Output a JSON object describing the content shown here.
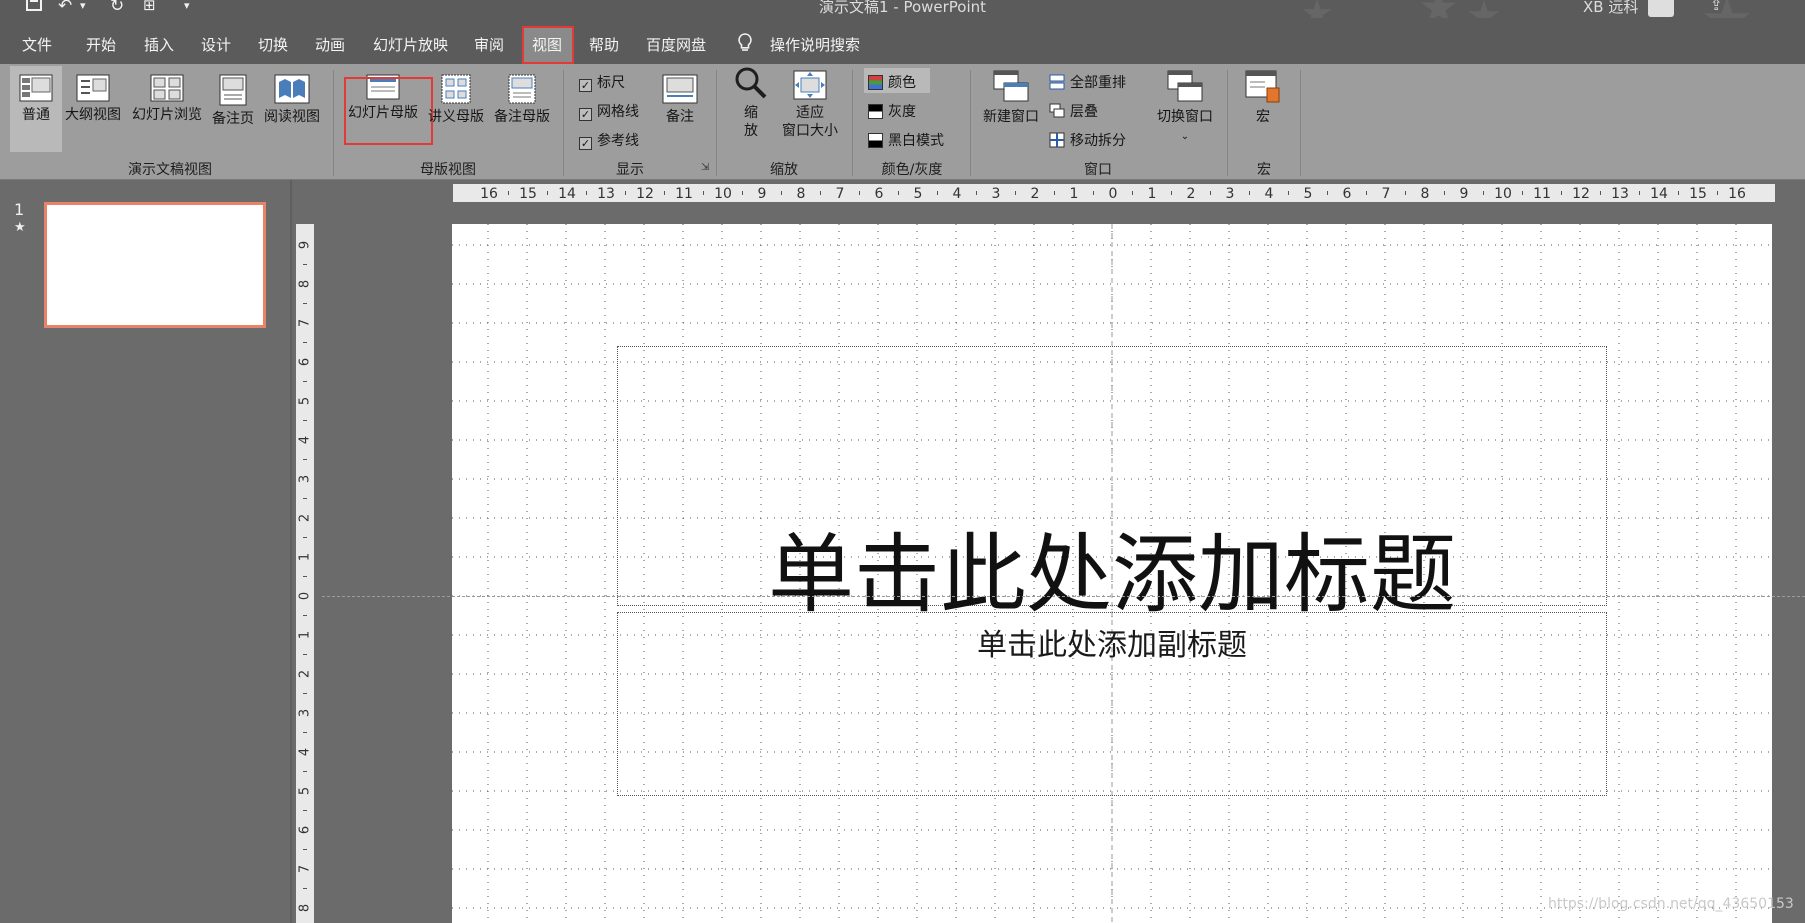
{
  "titlebar": {
    "doc_title": "演示文稿1  -  PowerPoint",
    "user": "XB 远科",
    "icons": [
      "save-icon",
      "undo-icon",
      "redo-icon",
      "start-from-beginning-icon",
      "customize-quick-access-icon",
      "share-icon"
    ]
  },
  "tabs": [
    "文件",
    "开始",
    "插入",
    "设计",
    "切换",
    "动画",
    "幻灯片放映",
    "审阅",
    "视图",
    "帮助",
    "百度网盘"
  ],
  "active_tab": "视图",
  "tell_me": "操作说明搜索",
  "ribbon": {
    "presentation_views": {
      "label": "演示文稿视图",
      "buttons": [
        "普通",
        "大纲视图",
        "幻灯片浏览",
        "备注页",
        "阅读视图"
      ]
    },
    "master_views": {
      "label": "母版视图",
      "buttons": [
        "幻灯片母版",
        "讲义母版",
        "备注母版"
      ]
    },
    "show": {
      "label": "显示",
      "checks": [
        "标尺",
        "网格线",
        "参考线"
      ],
      "notes": "备注"
    },
    "zoom": {
      "label": "缩放",
      "zoom_l1": "缩",
      "zoom_l2": "放",
      "fit_l1": "适应",
      "fit_l2": "窗口大小"
    },
    "color": {
      "label": "颜色/灰度",
      "options": [
        "颜色",
        "灰度",
        "黑白模式"
      ]
    },
    "window": {
      "label": "窗口",
      "new_window": "新建窗口",
      "options": [
        "全部重排",
        "层叠",
        "移动拆分"
      ],
      "switch": "切换窗口"
    },
    "macros": {
      "label": "宏",
      "button": "宏"
    }
  },
  "thumbnail": {
    "number": "1",
    "star": "★"
  },
  "hruler_labels": [
    "16",
    "15",
    "14",
    "13",
    "12",
    "11",
    "10",
    "9",
    "8",
    "7",
    "6",
    "5",
    "4",
    "3",
    "2",
    "1",
    "0",
    "1",
    "2",
    "3",
    "4",
    "5",
    "6",
    "7",
    "8",
    "9",
    "10",
    "11",
    "12",
    "13",
    "14",
    "15",
    "16"
  ],
  "vruler_labels": [
    "9",
    "8",
    "7",
    "6",
    "5",
    "4",
    "3",
    "2",
    "1",
    "0",
    "1",
    "2",
    "3",
    "4",
    "5",
    "6",
    "7",
    "8"
  ],
  "slide": {
    "title": "单击此处添加标题",
    "subtitle": "单击此处添加副标题"
  },
  "watermark": "https://blog.csdn.net/qq_43650153"
}
